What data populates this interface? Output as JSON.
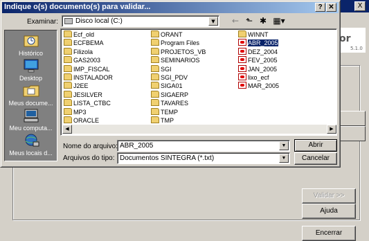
{
  "dialog": {
    "title": "Indique o(s) documento(s) para validar...",
    "help_label": "?",
    "close_label": "✕",
    "look_in_label": "Examinar:",
    "look_in_value": "Disco local (C:)",
    "toolbar": {
      "back_icon": "←",
      "up_icon": "⬑",
      "new_folder_icon": "✱",
      "view_icon": "▦▾"
    },
    "places": [
      {
        "label": "Histórico",
        "icon": "history-icon"
      },
      {
        "label": "Desktop",
        "icon": "desktop-icon"
      },
      {
        "label": "Meus docume...",
        "icon": "my-documents-icon"
      },
      {
        "label": "Meu computa...",
        "icon": "my-computer-icon"
      },
      {
        "label": "Meus locais d...",
        "icon": "network-places-icon"
      }
    ],
    "files": [
      {
        "name": "Ecf_old",
        "type": "folder"
      },
      {
        "name": "ECFBEMA",
        "type": "folder"
      },
      {
        "name": "Filizola",
        "type": "folder"
      },
      {
        "name": "GAS2003",
        "type": "folder"
      },
      {
        "name": "IMP_FISCAL",
        "type": "folder"
      },
      {
        "name": "INSTALADOR",
        "type": "folder"
      },
      {
        "name": "J2EE",
        "type": "folder"
      },
      {
        "name": "JESILVER",
        "type": "folder"
      },
      {
        "name": "LISTA_CTBC",
        "type": "folder"
      },
      {
        "name": "MP3",
        "type": "folder"
      },
      {
        "name": "ORACLE",
        "type": "folder"
      },
      {
        "name": "ORANT",
        "type": "folder"
      },
      {
        "name": "Program Files",
        "type": "folder"
      },
      {
        "name": "PROJETOS_VB",
        "type": "folder"
      },
      {
        "name": "SEMINARIOS",
        "type": "folder"
      },
      {
        "name": "SGI",
        "type": "folder"
      },
      {
        "name": "SGI_PDV",
        "type": "folder"
      },
      {
        "name": "SIGA01",
        "type": "folder"
      },
      {
        "name": "SIGAERP",
        "type": "folder"
      },
      {
        "name": "TAVARES",
        "type": "folder"
      },
      {
        "name": "TEMP",
        "type": "folder"
      },
      {
        "name": "TMP",
        "type": "folder"
      },
      {
        "name": "WINNT",
        "type": "folder"
      },
      {
        "name": "ABR_2005",
        "type": "doc",
        "selected": true
      },
      {
        "name": "DEZ_2004",
        "type": "doc"
      },
      {
        "name": "FEV_2005",
        "type": "doc"
      },
      {
        "name": "JAN_2005",
        "type": "doc"
      },
      {
        "name": "lixo_ecf",
        "type": "doc"
      },
      {
        "name": "MAR_2005",
        "type": "doc"
      }
    ],
    "filename_label": "Nome do arquivo:",
    "filename_value": "ABR_2005",
    "filetype_label": "Arquivos do tipo:",
    "filetype_value": "Documentos SINTEGRA (*.txt)",
    "open_label": "Abrir",
    "cancel_label": "Cancelar"
  },
  "background": {
    "close_label": "X",
    "logo_text": "or",
    "version": "5.1.0",
    "validar_label": "Validar >>",
    "ajuda_label": "Ajuda",
    "encerrar_label": "Encerrar"
  }
}
